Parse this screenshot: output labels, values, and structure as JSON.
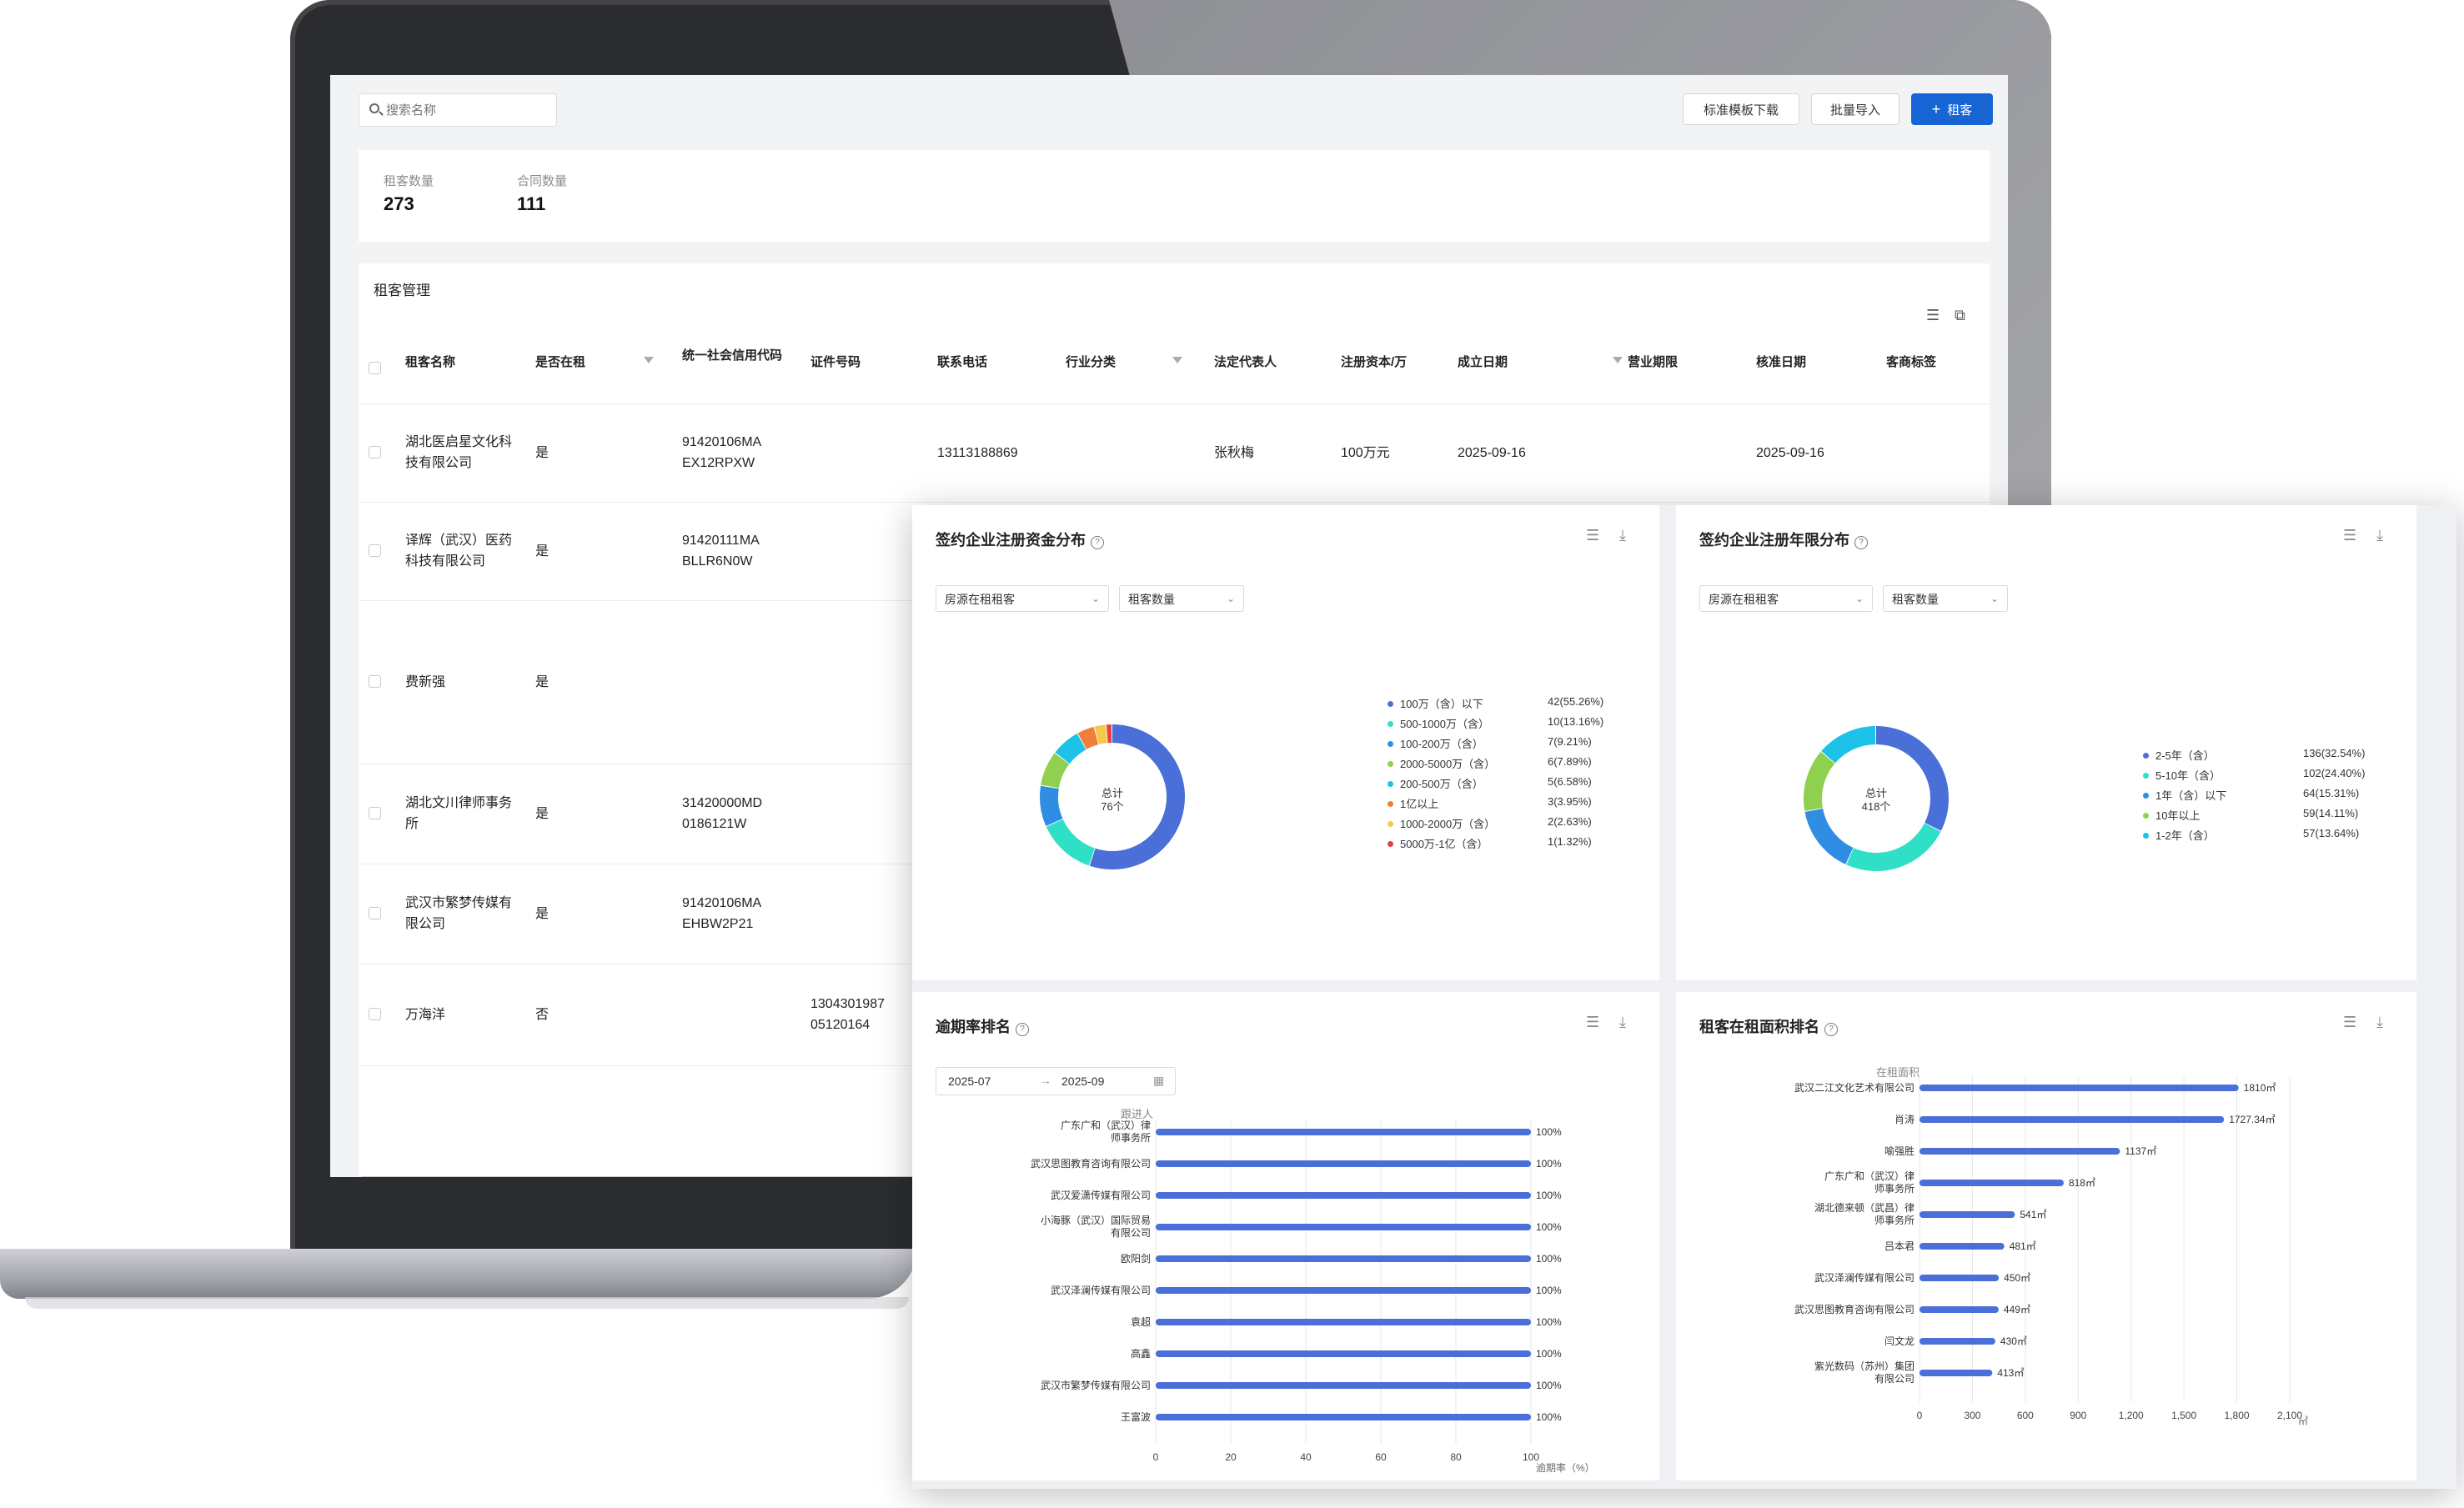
{
  "toolbar": {
    "search_placeholder": "搜索名称",
    "template_download": "标准模板下载",
    "batch_import": "批量导入",
    "add_tenant": "租客",
    "add_symbol": "+"
  },
  "stats": {
    "tenant_count_label": "租客数量",
    "tenant_count": "273",
    "contract_count_label": "合同数量",
    "contract_count": "111"
  },
  "table": {
    "title": "租客管理",
    "headers": [
      "租客名称",
      "是否在租",
      "统一社会信用代码",
      "证件号码",
      "联系电话",
      "行业分类",
      "法定代表人",
      "注册资本/万",
      "成立日期",
      "营业期限",
      "核准日期",
      "客商标签"
    ],
    "rows": [
      {
        "name": "湖北医启星文化科技有限公司",
        "renting": "是",
        "credit": "91420106MAEX12RPXW",
        "id": "",
        "phone": "13113188869",
        "industry": "",
        "rep": "张秋梅",
        "capital": "100万元",
        "founded": "2025-09-16",
        "term": "",
        "approved": "2025-09-16"
      },
      {
        "name": "译辉（武汉）医药科技有限公司",
        "renting": "是",
        "credit": "91420111MABLLR6N0W",
        "id": "",
        "phone": "",
        "industry": "",
        "rep": "",
        "capital": "",
        "founded": "",
        "term": "",
        "approved": ""
      },
      {
        "name": "费新强",
        "renting": "是",
        "credit": "",
        "id": "",
        "phone": "",
        "industry": "",
        "rep": "",
        "capital": "",
        "founded": "",
        "term": "",
        "approved": ""
      },
      {
        "name": "湖北文川律师事务所",
        "renting": "是",
        "credit": "31420000MD0186121W",
        "id": "",
        "phone": "",
        "industry": "",
        "rep": "",
        "capital": "",
        "founded": "",
        "term": "",
        "approved": ""
      },
      {
        "name": "武汉市繁梦传媒有限公司",
        "renting": "是",
        "credit": "91420106MAEHBW2P21",
        "id": "",
        "phone": "",
        "industry": "",
        "rep": "",
        "capital": "",
        "founded": "",
        "term": "",
        "approved": ""
      },
      {
        "name": "万海洋",
        "renting": "否",
        "credit": "",
        "id": "130430198705120164",
        "phone": "",
        "industry": "",
        "rep": "",
        "capital": "",
        "founded": "",
        "term": "",
        "approved": ""
      }
    ]
  },
  "card_capital": {
    "title": "签约企业注册资金分布",
    "select1": "房源在租租客",
    "select2": "租客数量",
    "center_line1": "总计",
    "center_line2": "76个",
    "legend": [
      {
        "label": "100万（含）以下",
        "value": "42(55.26%)",
        "color": "#4a6fd8",
        "count": 42
      },
      {
        "label": "500-1000万（含）",
        "value": "10(13.16%)",
        "color": "#2fe0c6",
        "count": 10
      },
      {
        "label": "100-200万（含）",
        "value": "7(9.21%)",
        "color": "#2f8de4",
        "count": 7
      },
      {
        "label": "2000-5000万（含）",
        "value": "6(7.89%)",
        "color": "#8fd14f",
        "count": 6
      },
      {
        "label": "200-500万（含）",
        "value": "5(6.58%)",
        "color": "#1cc2e8",
        "count": 5
      },
      {
        "label": "1亿以上",
        "value": "3(3.95%)",
        "color": "#f07f3c",
        "count": 3
      },
      {
        "label": "1000-2000万（含）",
        "value": "2(2.63%)",
        "color": "#f5c84a",
        "count": 2
      },
      {
        "label": "5000万-1亿（含）",
        "value": "1(1.32%)",
        "color": "#e8423c",
        "count": 1
      }
    ]
  },
  "card_years": {
    "title": "签约企业注册年限分布",
    "select1": "房源在租租客",
    "select2": "租客数量",
    "center_line1": "总计",
    "center_line2": "418个",
    "legend": [
      {
        "label": "2-5年（含）",
        "value": "136(32.54%)",
        "color": "#4a6fd8",
        "count": 136
      },
      {
        "label": "5-10年（含）",
        "value": "102(24.40%)",
        "color": "#2fe0c6",
        "count": 102
      },
      {
        "label": "1年（含）以下",
        "value": "64(15.31%)",
        "color": "#2f8de4",
        "count": 64
      },
      {
        "label": "10年以上",
        "value": "59(14.11%)",
        "color": "#8fd14f",
        "count": 59
      },
      {
        "label": "1-2年（含）",
        "value": "57(13.64%)",
        "color": "#1cc2e8",
        "count": 57
      }
    ]
  },
  "card_overdue": {
    "title": "逾期率排名",
    "date_start": "2025-07",
    "date_sep": "→",
    "date_end": "2025-09",
    "series_label": "跟进人",
    "x_axis_label": "逾期率（%）",
    "x_ticks": [
      "0",
      "20",
      "40",
      "60",
      "80",
      "100"
    ],
    "chart_data": {
      "type": "bar",
      "orientation": "horizontal",
      "categories": [
        "广东广和（武汉）律师事务所",
        "武汉思图教育咨询有限公司",
        "武汉爱潇传媒有限公司",
        "小海豚（武汉）国际贸易有限公司",
        "欧阳剑",
        "武汉泽澜传媒有限公司",
        "袁超",
        "高鑫",
        "武汉市繁梦传媒有限公司",
        "王富波"
      ],
      "values": [
        100,
        100,
        100,
        100,
        100,
        100,
        100,
        100,
        100,
        100
      ],
      "value_labels": [
        "100%",
        "100%",
        "100%",
        "100%",
        "100%",
        "100%",
        "100%",
        "100%",
        "100%",
        "100%"
      ],
      "xlim": [
        0,
        100
      ],
      "color": "#4a6fd8"
    }
  },
  "card_area": {
    "title": "租客在租面积排名",
    "series_label": "在租面积",
    "unit": "㎡",
    "x_ticks": [
      "0",
      "300",
      "600",
      "900",
      "1,200",
      "1,500",
      "1,800",
      "2,100"
    ],
    "chart_data": {
      "type": "bar",
      "orientation": "horizontal",
      "categories": [
        "武汉二江文化艺术有限公司",
        "肖涛",
        "喻强胜",
        "广东广和（武汉）律师事务所",
        "湖北德来顿（武昌）律师事务所",
        "吕本君",
        "武汉泽澜传媒有限公司",
        "武汉思图教育咨询有限公司",
        "闫文龙",
        "紫光数码（苏州）集团有限公司"
      ],
      "values": [
        1810,
        1727.34,
        1137,
        818,
        541,
        481,
        450,
        449,
        430,
        413
      ],
      "value_labels": [
        "1810㎡",
        "1727.34㎡",
        "1137㎡",
        "818㎡",
        "541㎡",
        "481㎡",
        "450㎡",
        "449㎡",
        "430㎡",
        "413㎡"
      ],
      "xlim": [
        0,
        2100
      ],
      "color": "#4a6fd8"
    }
  }
}
